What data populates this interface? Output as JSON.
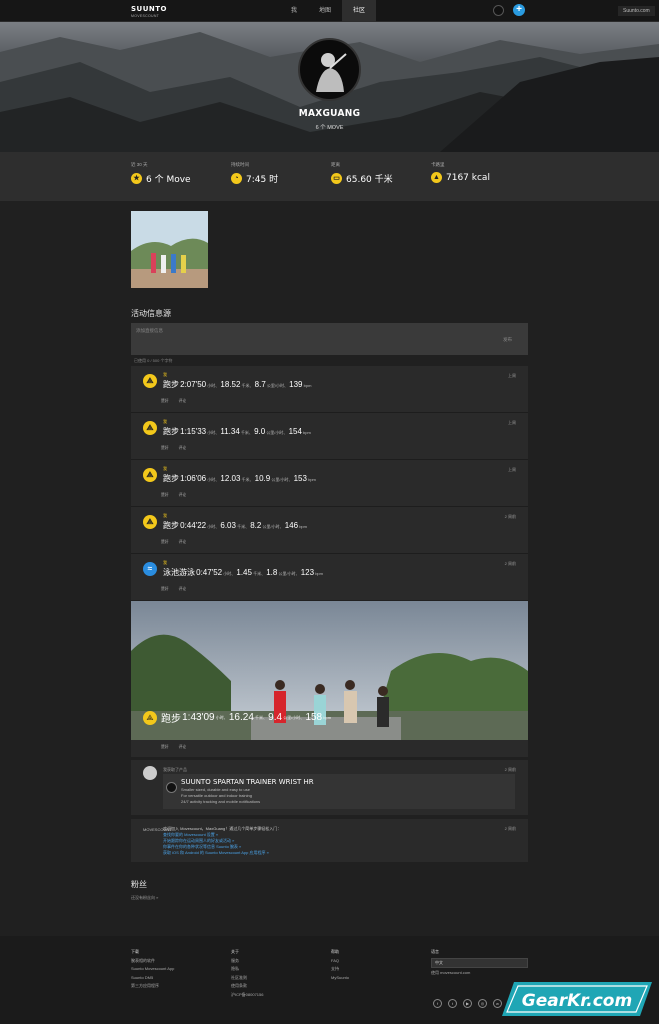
{
  "brand": {
    "name": "SUUNTO",
    "sub": "MOVESCOUNT"
  },
  "nav": {
    "items": [
      "我",
      "地图",
      "社区"
    ],
    "active": 2
  },
  "top_right": "Suunto.com",
  "profile": {
    "name": "MAXGUANG",
    "moves": "6 个 MOVE"
  },
  "stats": [
    {
      "label": "近 30 天",
      "value": "6 个 Move",
      "icon": "star-icon"
    },
    {
      "label": "持续时间",
      "value": "7:45 时",
      "icon": "clock-icon"
    },
    {
      "label": "距离",
      "value": "65.60 千米",
      "icon": "distance-icon"
    },
    {
      "label": "卡路里",
      "value": "7167 kcal",
      "icon": "flame-icon"
    }
  ],
  "feed": {
    "title": "活动信息源",
    "placeholder": "添加直接信息",
    "post_button": "发布",
    "quota": "已使用 0 / 500 个字符",
    "like": "赞好",
    "comment": "评论"
  },
  "moves": [
    {
      "who": "我",
      "sport": "跑步",
      "duration": "2:07'50",
      "distance": "18.52",
      "speed": "8.7",
      "hr": "139",
      "when": "上周",
      "icon": "running-icon"
    },
    {
      "who": "我",
      "sport": "跑步",
      "duration": "1:15'33",
      "distance": "11.34",
      "speed": "9.0",
      "hr": "154",
      "when": "上周",
      "icon": "running-icon"
    },
    {
      "who": "我",
      "sport": "跑步",
      "duration": "1:06'06",
      "distance": "12.03",
      "speed": "10.9",
      "hr": "153",
      "when": "上周",
      "icon": "running-icon"
    },
    {
      "who": "我",
      "sport": "跑步",
      "duration": "0:44'22",
      "distance": "6.03",
      "speed": "8.2",
      "hr": "146",
      "when": "2 周前",
      "icon": "running-icon"
    },
    {
      "who": "我",
      "sport": "泳池游泳",
      "duration": "0:47'52",
      "distance": "1.45",
      "speed": "1.8",
      "hr": "123",
      "when": "2 周前",
      "icon": "swimming-icon"
    }
  ],
  "units": {
    "hour": "小时、",
    "km": "千米、",
    "speed": "公里/小时、",
    "bpm": "bpm"
  },
  "photo_move": {
    "sport": "跑步",
    "duration": "1:43'09",
    "distance": "16.24",
    "speed": "9.4",
    "hr": "158"
  },
  "product": {
    "header": "我获取了产品",
    "when": "2 周前",
    "title": "SUUNTO SPARTAN TRAINER WRIST HR",
    "lines": [
      "Smaller sized, durable and easy to use",
      "For versatile outdoor and indoor training",
      "24/7 activity tracking and mobile notifications"
    ]
  },
  "welcome": {
    "when": "2 周前",
    "lines": [
      "欢迎加入 Movescount，MaxGuang！通过几个简单步骤轻松入门：",
      "查找你要的 Movescount 设置 »",
      "开始跟踪你在运动周围人的好友或活动 »",
      "你事件在你的各种状况等信息 Suunto 腕表 »",
      "获取 iOS 和 Android 的 Suunto Movescount App 应用程序 »"
    ]
  },
  "fans": {
    "title": "粉丝",
    "empty": "还没有粉丝向 »"
  },
  "footer": {
    "cols": [
      {
        "title": "下载",
        "items": [
          "腕表相的软件",
          "Suunto Movescount App",
          "Suunto DM5",
          "第三方应用程序"
        ]
      },
      {
        "title": "关于",
        "items": [
          "服务",
          "隐私",
          "社区准则",
          "使用条款",
          "沪ICP备08007156"
        ]
      },
      {
        "title": "帮助",
        "items": [
          "FAQ",
          "支持",
          "MySuunto"
        ]
      },
      {
        "title": "语言",
        "items": [
          "使用 movescount.com"
        ]
      }
    ],
    "language": "中文"
  },
  "watermark": "GearKr.com"
}
